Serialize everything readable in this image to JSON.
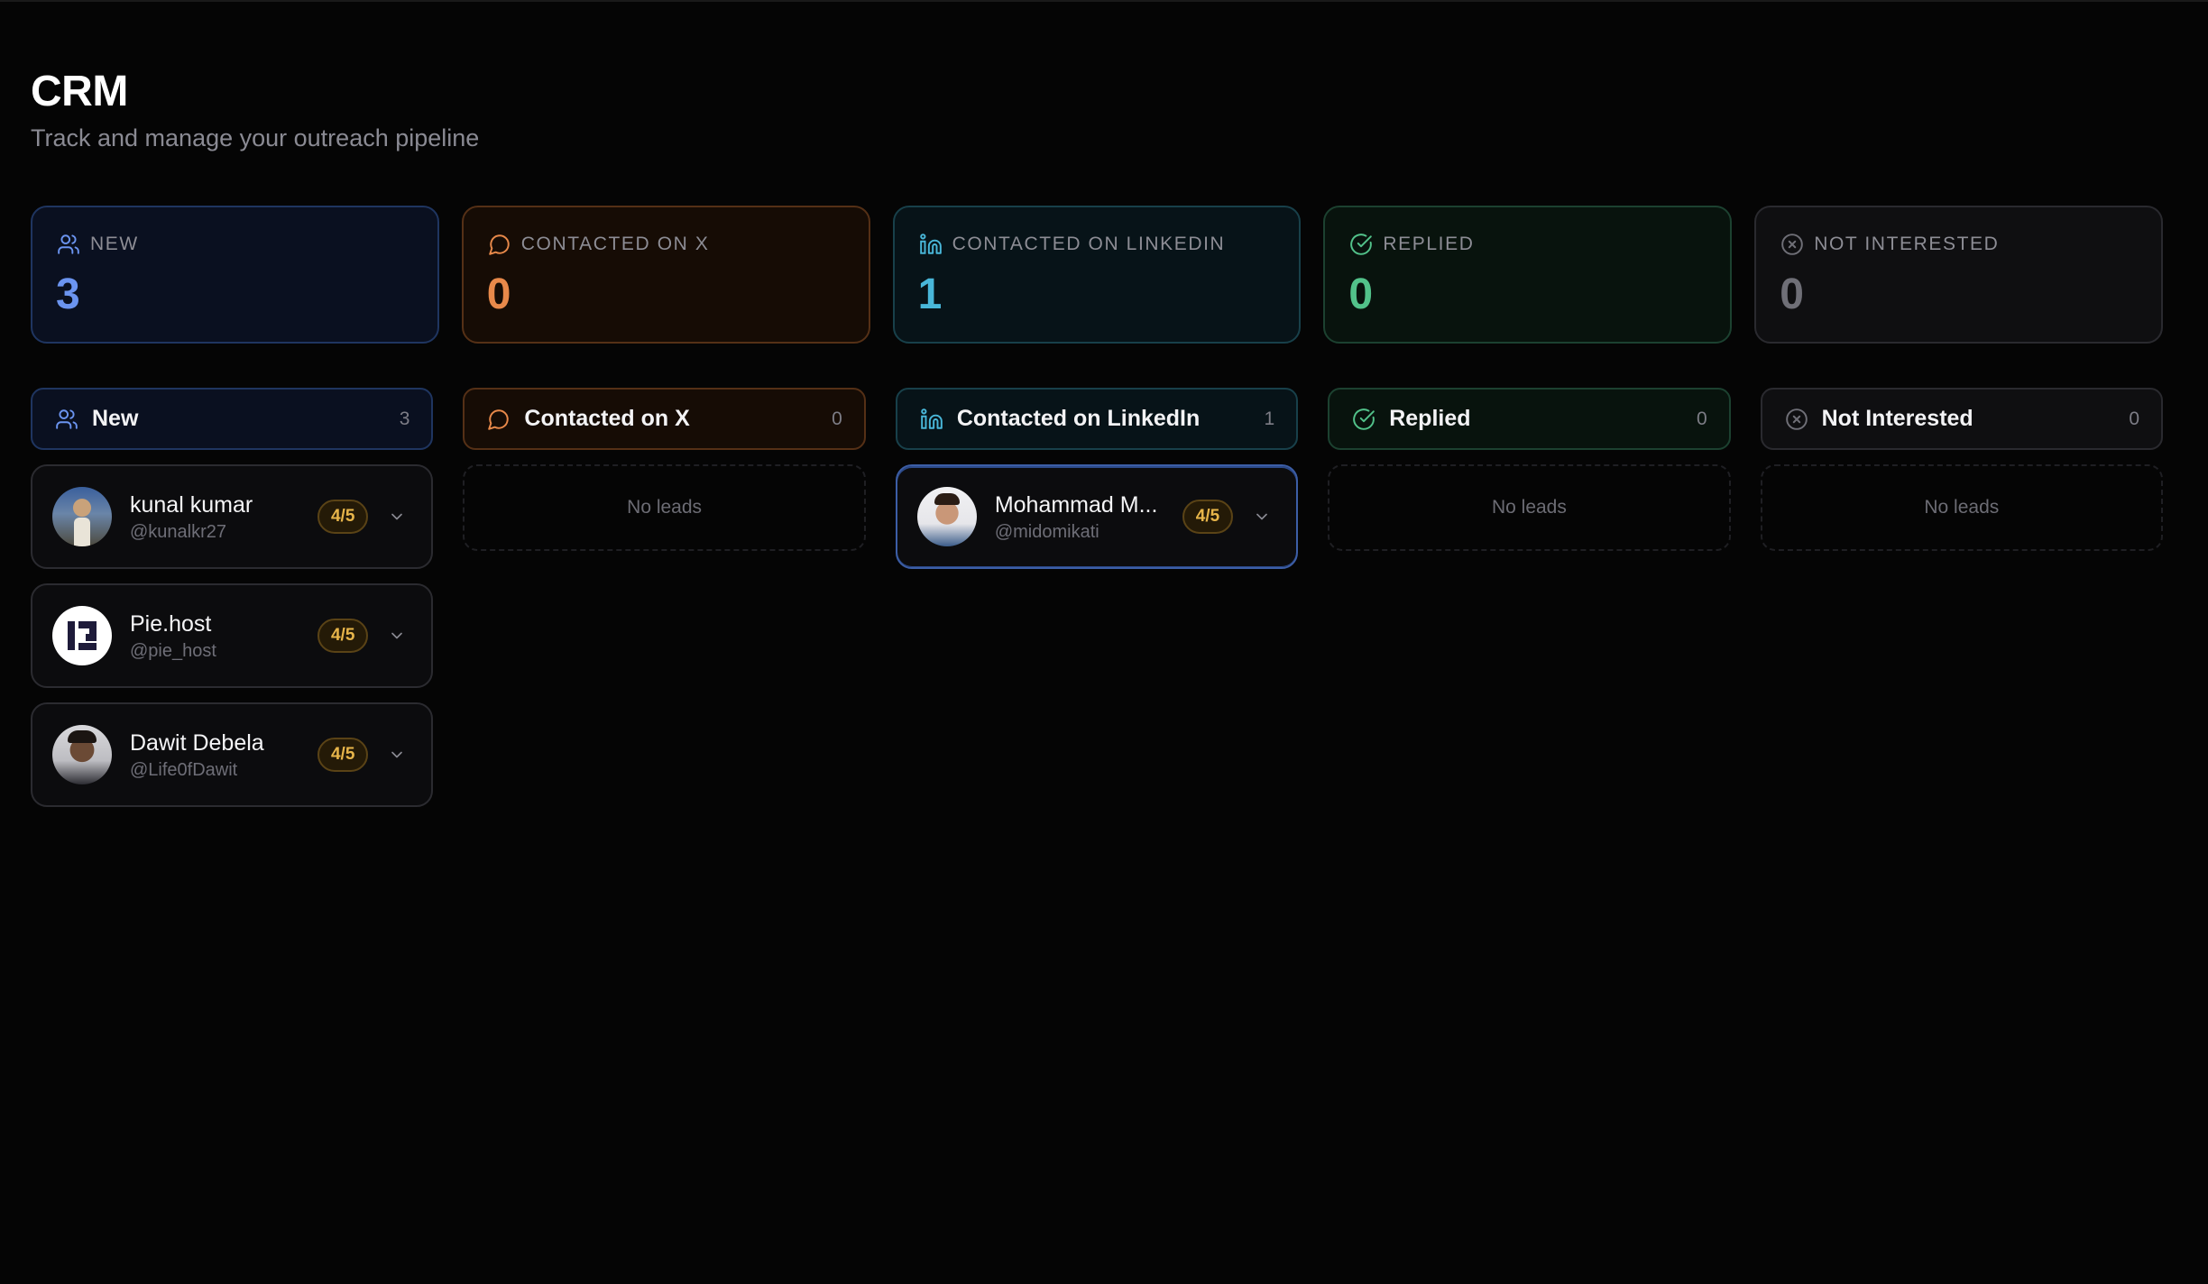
{
  "page": {
    "title": "CRM",
    "subtitle": "Track and manage your outreach pipeline"
  },
  "colors": {
    "new": "#6b94f0",
    "contacted_x": "#e8894a",
    "contacted_linkedin": "#49b7d9",
    "replied": "#52c28a",
    "not_interested": "#6f6f77"
  },
  "stats": [
    {
      "label": "NEW",
      "value": "3",
      "icon": "users-icon"
    },
    {
      "label": "CONTACTED ON X",
      "value": "0",
      "icon": "message-circle-icon"
    },
    {
      "label": "CONTACTED ON LINKEDIN",
      "value": "1",
      "icon": "linkedin-icon"
    },
    {
      "label": "REPLIED",
      "value": "0",
      "icon": "check-circle-icon"
    },
    {
      "label": "NOT INTERESTED",
      "value": "0",
      "icon": "x-circle-icon"
    }
  ],
  "columns": [
    {
      "title": "New",
      "count": "3",
      "icon": "users-icon",
      "leads": [
        {
          "name": "kunal kumar",
          "handle": "@kunalkr27",
          "score": "4/5"
        },
        {
          "name": "Pie.host",
          "handle": "@pie_host",
          "score": "4/5"
        },
        {
          "name": "Dawit Debela",
          "handle": "@Life0fDawit",
          "score": "4/5"
        }
      ]
    },
    {
      "title": "Contacted on X",
      "count": "0",
      "icon": "message-circle-icon",
      "empty_text": "No leads"
    },
    {
      "title": "Contacted on LinkedIn",
      "count": "1",
      "icon": "linkedin-icon",
      "leads": [
        {
          "name": "Mohammad M...",
          "handle": "@midomikati",
          "score": "4/5"
        }
      ]
    },
    {
      "title": "Replied",
      "count": "0",
      "icon": "check-circle-icon",
      "empty_text": "No leads"
    },
    {
      "title": "Not Interested",
      "count": "0",
      "icon": "x-circle-icon",
      "empty_text": "No leads"
    }
  ]
}
